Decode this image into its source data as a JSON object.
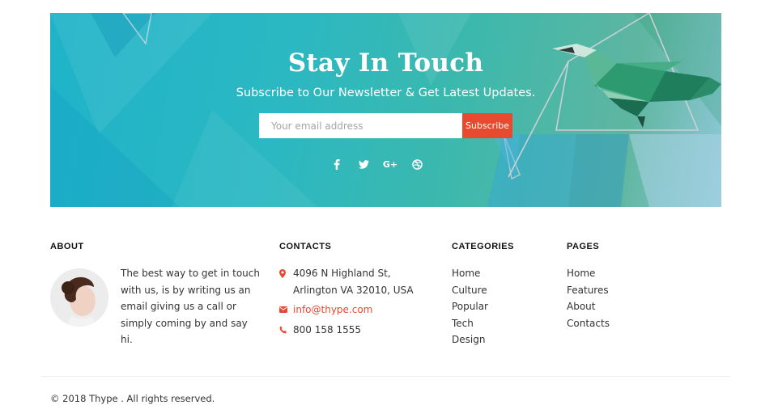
{
  "newsletter": {
    "title": "Stay In Touch",
    "subtitle": "Subscribe to Our Newsletter & Get Latest Updates.",
    "email_placeholder": "Your email address",
    "subscribe_label": "Subscribe",
    "social_icons": [
      "facebook-icon",
      "twitter-icon",
      "google-plus-icon",
      "dribbble-icon"
    ]
  },
  "about": {
    "heading": "ABOUT",
    "text": "The best way to get in touch with us, is by writing us an email giving us a call or simply coming by and say hi."
  },
  "contacts": {
    "heading": "CONTACTS",
    "address_line1": "4096 N Highland St,",
    "address_line2": "Arlington VA 32010, USA",
    "email": "info@thype.com",
    "phone": "800 158 1555"
  },
  "categories": {
    "heading": "CATEGORIES",
    "items": [
      "Home",
      "Culture",
      "Popular",
      "Tech",
      "Design"
    ]
  },
  "pages": {
    "heading": "PAGES",
    "items": [
      "Home",
      "Features",
      "About",
      "Contacts"
    ]
  },
  "footer": {
    "copyright": "© 2018 Thype . All rights reserved."
  },
  "colors": {
    "accent": "#e84a2f",
    "banner_start": "#1fb3c9",
    "banner_end": "#8fc8d8"
  }
}
